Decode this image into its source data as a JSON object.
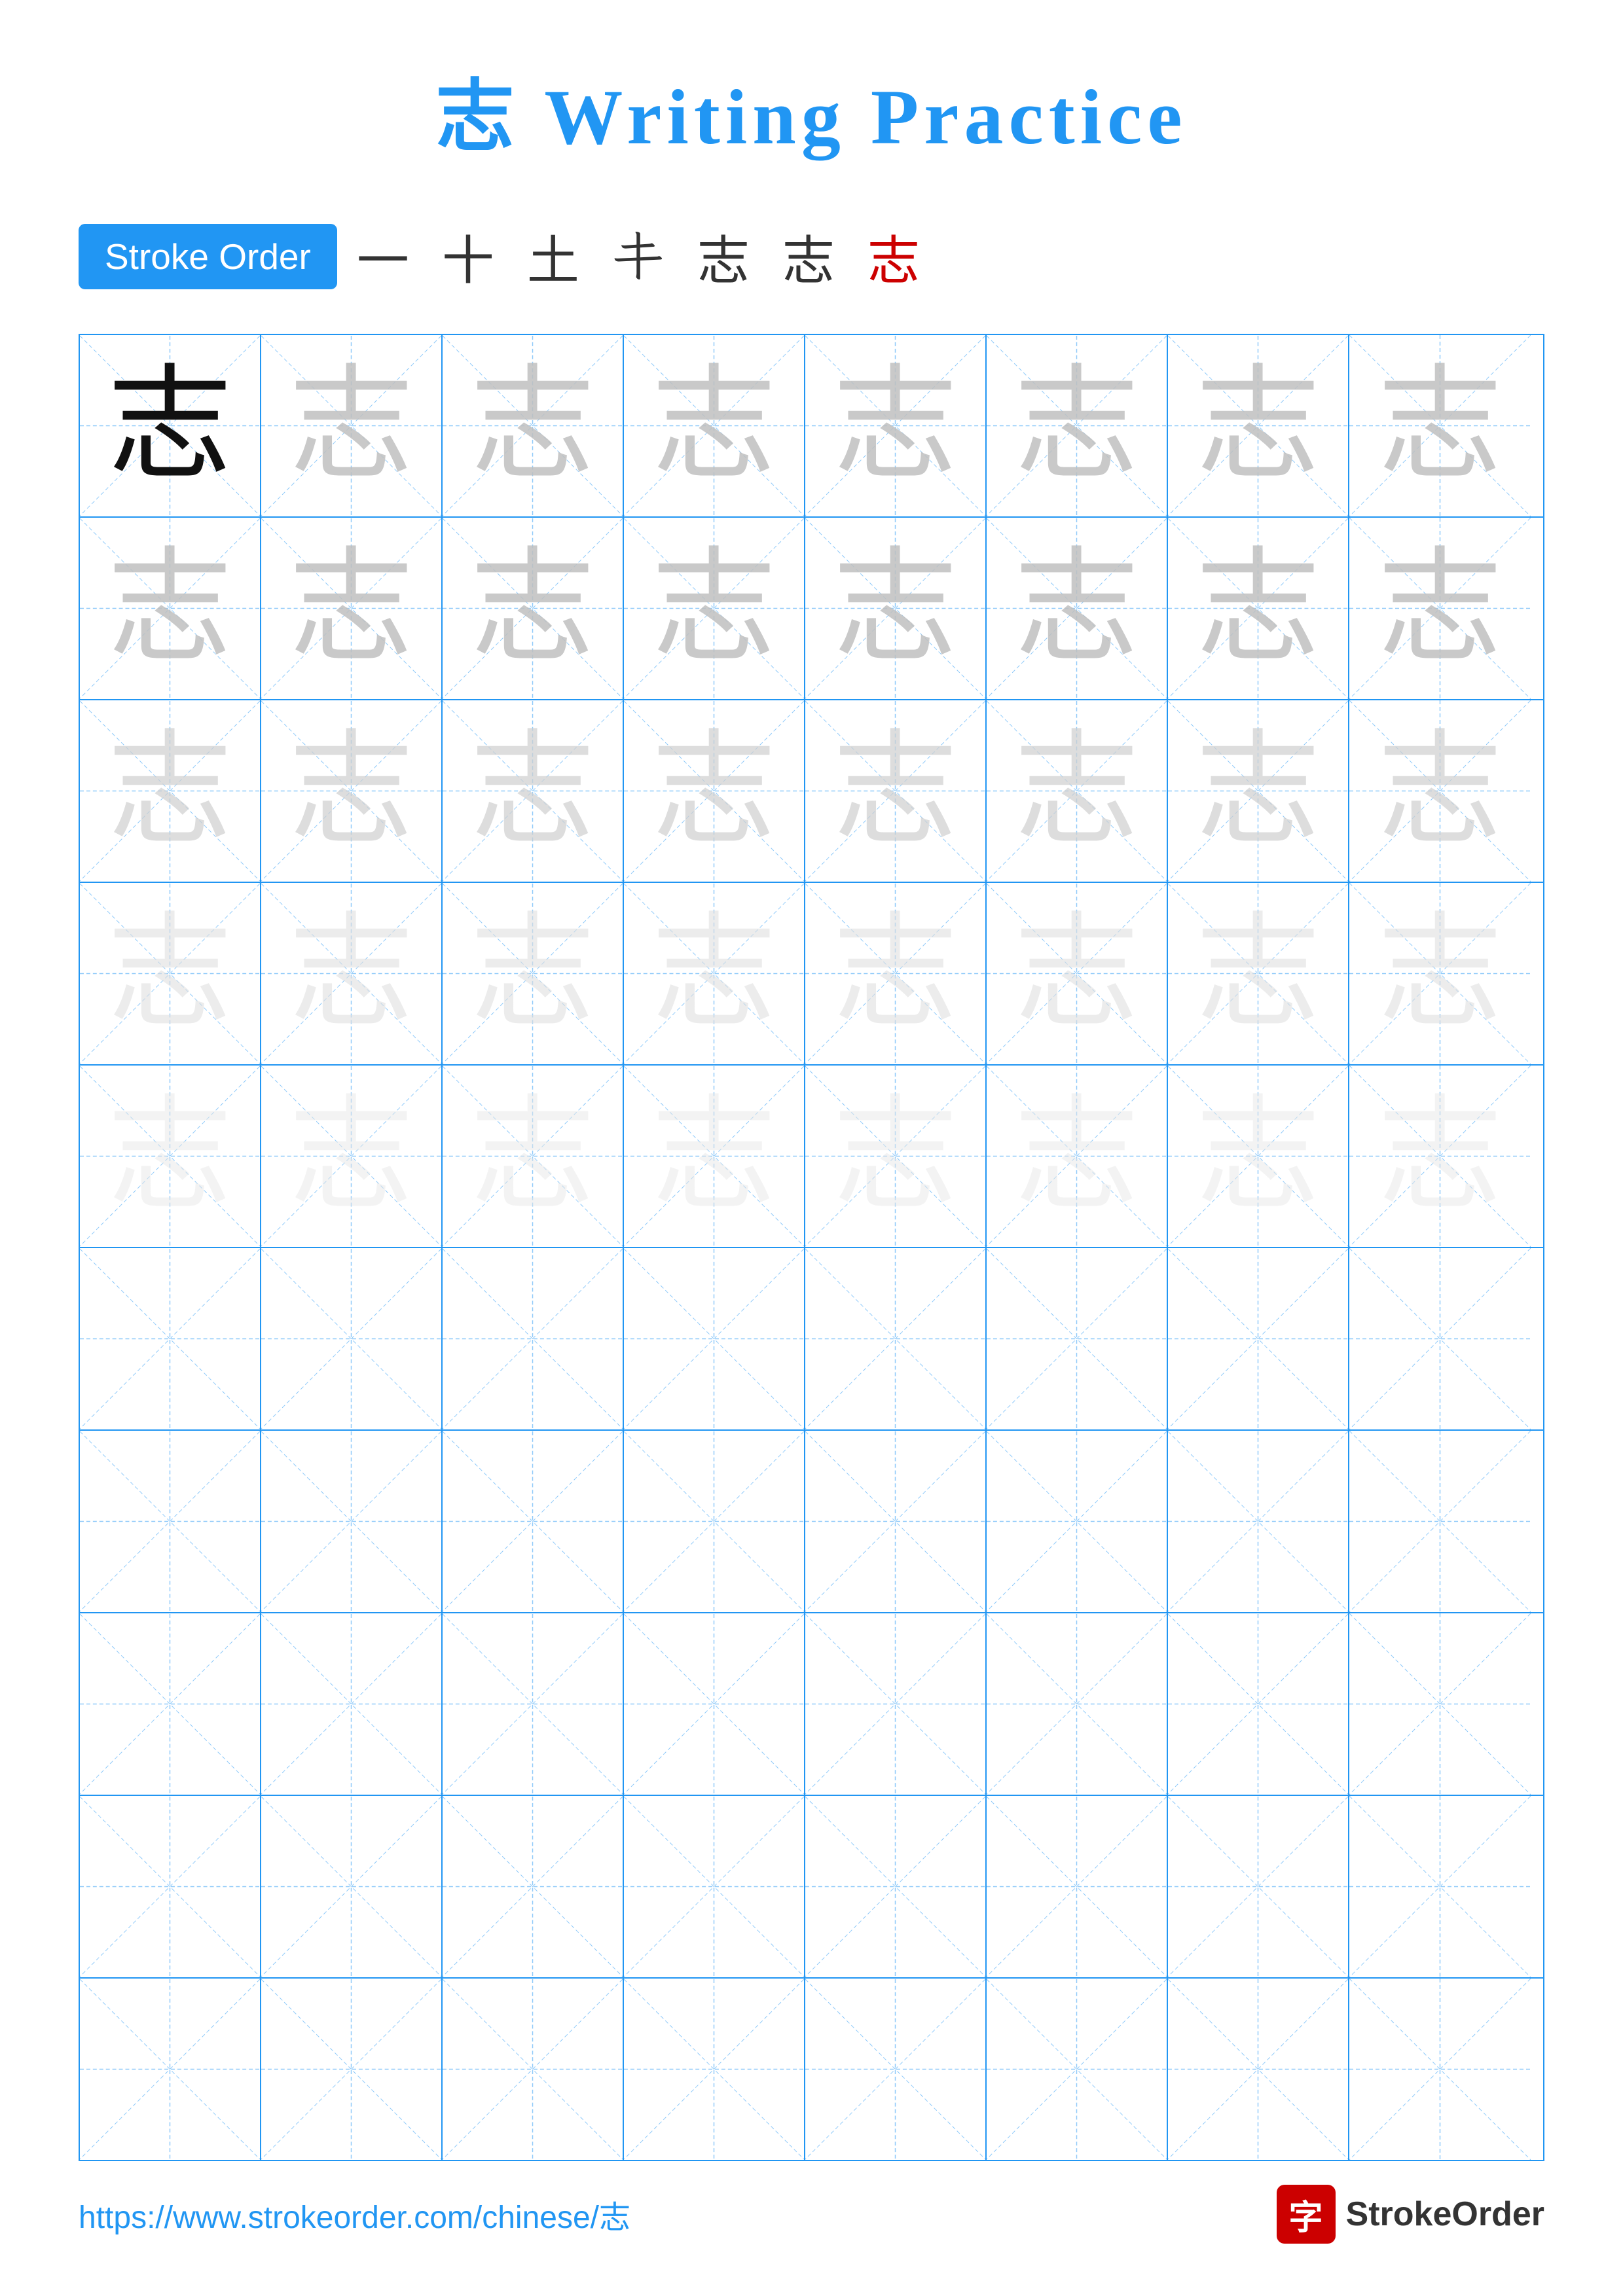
{
  "page": {
    "title": "志 Writing Practice",
    "title_color": "#2196F3"
  },
  "stroke_order": {
    "badge_label": "Stroke Order",
    "strokes": [
      "一",
      "+",
      "土",
      "𰀁",
      "志",
      "志",
      "志"
    ]
  },
  "grid": {
    "rows": 10,
    "cols": 8,
    "char": "志",
    "filled_rows": 5,
    "row_opacities": [
      "dark",
      "light1",
      "light2",
      "light3",
      "light4"
    ]
  },
  "footer": {
    "url": "https://www.strokeorder.com/chinese/志",
    "logo_text": "StrokeOrder",
    "logo_char": "字"
  }
}
